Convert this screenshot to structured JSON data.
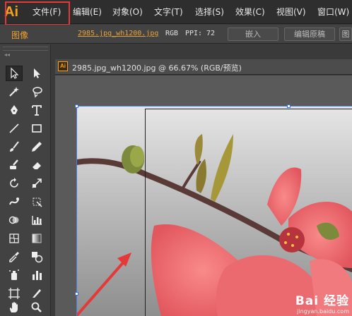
{
  "app": {
    "logo": "Ai"
  },
  "menubar": {
    "items": [
      "文件(F)",
      "编辑(E)",
      "对象(O)",
      "文字(T)",
      "选择(S)",
      "效果(C)",
      "视图(V)",
      "窗口(W)"
    ]
  },
  "controlbar": {
    "mode_label": "图像",
    "file_link": "2985.jpg_wh1200.jpg",
    "color_mode": "RGB",
    "ppi_label": "PPI:",
    "ppi_value": "72",
    "embed_button": "嵌入",
    "edit_original_button": "编辑原稿",
    "overflow_button": "图"
  },
  "toolbar": {
    "tools": [
      "selection-tool",
      "direct-selection-tool",
      "magic-wand-tool",
      "lasso-tool",
      "pen-tool",
      "type-tool",
      "line-tool",
      "rectangle-tool",
      "paintbrush-tool",
      "pencil-tool",
      "blob-brush-tool",
      "eraser-tool",
      "rotate-tool",
      "scale-tool",
      "warp-tool",
      "free-transform-tool",
      "shape-builder-tool",
      "graph-tool",
      "mesh-tool",
      "gradient-tool",
      "eyedropper-tool",
      "blend-tool",
      "symbol-sprayer-tool",
      "column-graph-tool",
      "artboard-tool",
      "slice-tool",
      "hand-tool",
      "zoom-tool"
    ]
  },
  "document": {
    "icon": "Ai",
    "title": "2985.jpg_wh1200.jpg @ 66.67% (RGB/预览)"
  },
  "watermark": {
    "logo": "Bai 经验",
    "site": "jingyan.baidu.com"
  },
  "colors": {
    "accent": "#f7a21b",
    "highlight": "#e53838",
    "selection": "#4a7ee6"
  }
}
